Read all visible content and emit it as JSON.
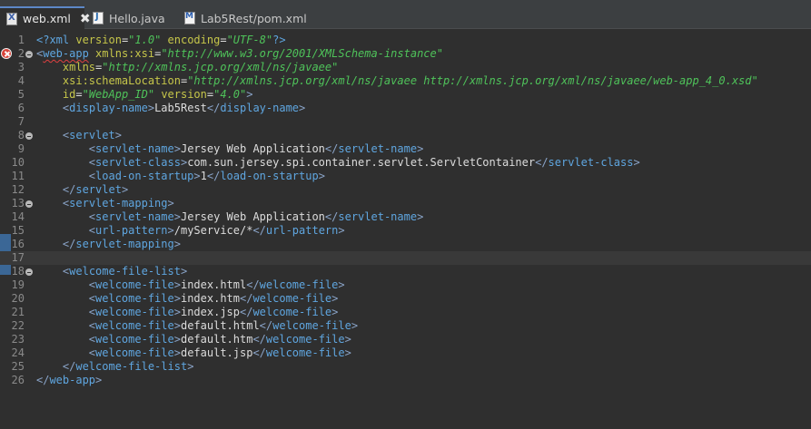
{
  "tabs": [
    {
      "label": "web.xml",
      "icon": "xml-file-icon",
      "active": true
    },
    {
      "label": "Hello.java",
      "icon": "java-file-icon",
      "active": false
    },
    {
      "label": "Lab5Rest/pom.xml",
      "icon": "maven-file-icon",
      "active": false
    }
  ],
  "tab_close_glyph": "✖",
  "editor": {
    "lines": [
      {
        "n": "1",
        "tokens": [
          [
            "pi",
            "<?xml "
          ],
          [
            "attr",
            "version"
          ],
          [
            "plain",
            "="
          ],
          [
            "str",
            "\"1.0\""
          ],
          [
            "plain",
            " "
          ],
          [
            "attr",
            "encoding"
          ],
          [
            "plain",
            "="
          ],
          [
            "str",
            "\"UTF-8\""
          ],
          [
            "pi",
            "?>"
          ]
        ]
      },
      {
        "n": "2",
        "tokens": [
          [
            "bracket",
            "<"
          ],
          [
            "tag",
            "web-app"
          ],
          [
            "plain",
            " "
          ],
          [
            "attr",
            "xmlns:xsi"
          ],
          [
            "plain",
            "="
          ],
          [
            "str",
            "\"http://www.w3.org/2001/XMLSchema-instance\""
          ]
        ],
        "error": true,
        "fold": true
      },
      {
        "n": "3",
        "tokens": [
          [
            "plain",
            "    "
          ],
          [
            "attr",
            "xmlns"
          ],
          [
            "plain",
            "="
          ],
          [
            "str",
            "\"http://xmlns.jcp.org/xml/ns/javaee\""
          ]
        ]
      },
      {
        "n": "4",
        "tokens": [
          [
            "plain",
            "    "
          ],
          [
            "attr",
            "xsi:schemaLocation"
          ],
          [
            "plain",
            "="
          ],
          [
            "str",
            "\"http://xmlns.jcp.org/xml/ns/javaee http://xmlns.jcp.org/xml/ns/javaee/web-app_4_0.xsd\""
          ]
        ]
      },
      {
        "n": "5",
        "tokens": [
          [
            "plain",
            "    "
          ],
          [
            "attr",
            "id"
          ],
          [
            "plain",
            "="
          ],
          [
            "str",
            "\"WebApp_ID\""
          ],
          [
            "plain",
            " "
          ],
          [
            "attr",
            "version"
          ],
          [
            "plain",
            "="
          ],
          [
            "str",
            "\"4.0\""
          ],
          [
            "bracket",
            ">"
          ]
        ]
      },
      {
        "n": "6",
        "tokens": [
          [
            "plain",
            "    "
          ],
          [
            "bracket",
            "<"
          ],
          [
            "tag",
            "display-name"
          ],
          [
            "bracket",
            ">"
          ],
          [
            "plain",
            "Lab5Rest"
          ],
          [
            "bracket",
            "</"
          ],
          [
            "tag",
            "display-name"
          ],
          [
            "bracket",
            ">"
          ]
        ]
      },
      {
        "n": "7",
        "tokens": []
      },
      {
        "n": "8",
        "tokens": [
          [
            "plain",
            "    "
          ],
          [
            "bracket",
            "<"
          ],
          [
            "tag",
            "servlet"
          ],
          [
            "bracket",
            ">"
          ]
        ],
        "fold": true
      },
      {
        "n": "9",
        "tokens": [
          [
            "plain",
            "        "
          ],
          [
            "bracket",
            "<"
          ],
          [
            "tag",
            "servlet-name"
          ],
          [
            "bracket",
            ">"
          ],
          [
            "plain",
            "Jersey Web Application"
          ],
          [
            "bracket",
            "</"
          ],
          [
            "tag",
            "servlet-name"
          ],
          [
            "bracket",
            ">"
          ]
        ]
      },
      {
        "n": "10",
        "tokens": [
          [
            "plain",
            "        "
          ],
          [
            "bracket",
            "<"
          ],
          [
            "tag",
            "servlet-class"
          ],
          [
            "bracket",
            ">"
          ],
          [
            "plain",
            "com.sun.jersey.spi.container.servlet.ServletContainer"
          ],
          [
            "bracket",
            "</"
          ],
          [
            "tag",
            "servlet-class"
          ],
          [
            "bracket",
            ">"
          ]
        ]
      },
      {
        "n": "11",
        "tokens": [
          [
            "plain",
            "        "
          ],
          [
            "bracket",
            "<"
          ],
          [
            "tag",
            "load-on-startup"
          ],
          [
            "bracket",
            ">"
          ],
          [
            "plain",
            "1"
          ],
          [
            "bracket",
            "</"
          ],
          [
            "tag",
            "load-on-startup"
          ],
          [
            "bracket",
            ">"
          ]
        ]
      },
      {
        "n": "12",
        "tokens": [
          [
            "plain",
            "    "
          ],
          [
            "bracket",
            "</"
          ],
          [
            "tag",
            "servlet"
          ],
          [
            "bracket",
            ">"
          ]
        ]
      },
      {
        "n": "13",
        "tokens": [
          [
            "plain",
            "    "
          ],
          [
            "bracket",
            "<"
          ],
          [
            "tag",
            "servlet-mapping"
          ],
          [
            "bracket",
            ">"
          ]
        ],
        "fold": true
      },
      {
        "n": "14",
        "tokens": [
          [
            "plain",
            "        "
          ],
          [
            "bracket",
            "<"
          ],
          [
            "tag",
            "servlet-name"
          ],
          [
            "bracket",
            ">"
          ],
          [
            "plain",
            "Jersey Web Application"
          ],
          [
            "bracket",
            "</"
          ],
          [
            "tag",
            "servlet-name"
          ],
          [
            "bracket",
            ">"
          ]
        ]
      },
      {
        "n": "15",
        "tokens": [
          [
            "plain",
            "        "
          ],
          [
            "bracket",
            "<"
          ],
          [
            "tag",
            "url-pattern"
          ],
          [
            "bracket",
            ">"
          ],
          [
            "plain",
            "/myService/*"
          ],
          [
            "bracket",
            "</"
          ],
          [
            "tag",
            "url-pattern"
          ],
          [
            "bracket",
            ">"
          ]
        ]
      },
      {
        "n": "16",
        "tokens": [
          [
            "plain",
            "    "
          ],
          [
            "bracket",
            "</"
          ],
          [
            "tag",
            "servlet-mapping"
          ],
          [
            "bracket",
            ">"
          ]
        ]
      },
      {
        "n": "17",
        "tokens": [],
        "current": true
      },
      {
        "n": "18",
        "tokens": [
          [
            "plain",
            "    "
          ],
          [
            "bracket",
            "<"
          ],
          [
            "tag",
            "welcome-file-list"
          ],
          [
            "bracket",
            ">"
          ]
        ],
        "fold": true
      },
      {
        "n": "19",
        "tokens": [
          [
            "plain",
            "        "
          ],
          [
            "bracket",
            "<"
          ],
          [
            "tag",
            "welcome-file"
          ],
          [
            "bracket",
            ">"
          ],
          [
            "plain",
            "index.html"
          ],
          [
            "bracket",
            "</"
          ],
          [
            "tag",
            "welcome-file"
          ],
          [
            "bracket",
            ">"
          ]
        ]
      },
      {
        "n": "20",
        "tokens": [
          [
            "plain",
            "        "
          ],
          [
            "bracket",
            "<"
          ],
          [
            "tag",
            "welcome-file"
          ],
          [
            "bracket",
            ">"
          ],
          [
            "plain",
            "index.htm"
          ],
          [
            "bracket",
            "</"
          ],
          [
            "tag",
            "welcome-file"
          ],
          [
            "bracket",
            ">"
          ]
        ]
      },
      {
        "n": "21",
        "tokens": [
          [
            "plain",
            "        "
          ],
          [
            "bracket",
            "<"
          ],
          [
            "tag",
            "welcome-file"
          ],
          [
            "bracket",
            ">"
          ],
          [
            "plain",
            "index.jsp"
          ],
          [
            "bracket",
            "</"
          ],
          [
            "tag",
            "welcome-file"
          ],
          [
            "bracket",
            ">"
          ]
        ]
      },
      {
        "n": "22",
        "tokens": [
          [
            "plain",
            "        "
          ],
          [
            "bracket",
            "<"
          ],
          [
            "tag",
            "welcome-file"
          ],
          [
            "bracket",
            ">"
          ],
          [
            "plain",
            "default.html"
          ],
          [
            "bracket",
            "</"
          ],
          [
            "tag",
            "welcome-file"
          ],
          [
            "bracket",
            ">"
          ]
        ]
      },
      {
        "n": "23",
        "tokens": [
          [
            "plain",
            "        "
          ],
          [
            "bracket",
            "<"
          ],
          [
            "tag",
            "welcome-file"
          ],
          [
            "bracket",
            ">"
          ],
          [
            "plain",
            "default.htm"
          ],
          [
            "bracket",
            "</"
          ],
          [
            "tag",
            "welcome-file"
          ],
          [
            "bracket",
            ">"
          ]
        ]
      },
      {
        "n": "24",
        "tokens": [
          [
            "plain",
            "        "
          ],
          [
            "bracket",
            "<"
          ],
          [
            "tag",
            "welcome-file"
          ],
          [
            "bracket",
            ">"
          ],
          [
            "plain",
            "default.jsp"
          ],
          [
            "bracket",
            "</"
          ],
          [
            "tag",
            "welcome-file"
          ],
          [
            "bracket",
            ">"
          ]
        ]
      },
      {
        "n": "25",
        "tokens": [
          [
            "plain",
            "    "
          ],
          [
            "bracket",
            "</"
          ],
          [
            "tag",
            "welcome-file-list"
          ],
          [
            "bracket",
            ">"
          ]
        ]
      },
      {
        "n": "26",
        "tokens": [
          [
            "bracket",
            "</"
          ],
          [
            "tag",
            "web-app"
          ],
          [
            "bracket",
            ">"
          ]
        ]
      }
    ]
  },
  "colors": {
    "background": "#2f2f2f",
    "tag": "#5fa6e0",
    "attribute": "#c6c64a",
    "string": "#4fc35a",
    "text": "#dcdcdc",
    "error": "#d8443a",
    "active_tab_border": "#5d88c7"
  }
}
